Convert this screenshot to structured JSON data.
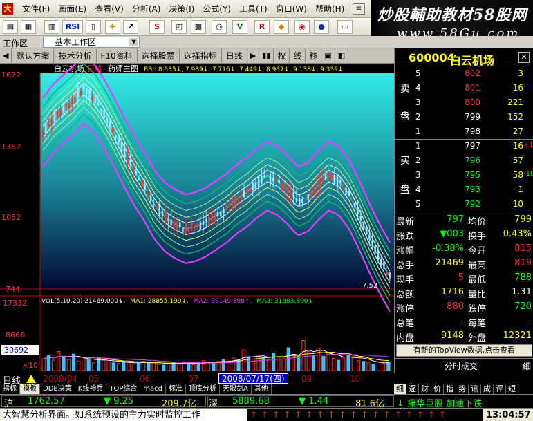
{
  "menu": [
    "文件(F)",
    "画面(E)",
    "查看(V)",
    "分析(A)",
    "决策(I)",
    "公式(Y)",
    "工具(T)",
    "窗口(W)",
    "帮助(H)"
  ],
  "banner": {
    "line1": "炒股輔助教材58股网",
    "line2": "www.58Gu.com"
  },
  "toolbar_labels": {
    "rsi": "RSI",
    "s": "S",
    "v": "V",
    "r": "R"
  },
  "workarea": {
    "label": "工作区",
    "value": "基本工作区"
  },
  "analysis_tabs": [
    "默认方案",
    "技术分析",
    "F10资料",
    "选择股票",
    "选择指标",
    "日线",
    "权",
    "线",
    "移"
  ],
  "chart_title": {
    "stock": "白云机场",
    "period": "日线",
    "indicator": "药师主图"
  },
  "bbi_line": "BBI: 8.535↓, 7.989↓, 7.716↓, 7.449↓, 8.937↓, 9.138↓, 9.339↓",
  "vol_line": {
    "prefix": "VOL(5,10,20) 21469.000↓,",
    "ma1": "MA1: 28855.199↓,",
    "ma2": "MA2: 39149.898↑,",
    "ma3": "MA3: 31883.600↓"
  },
  "price_axis": [
    "1672",
    "1362",
    "1052",
    "744"
  ],
  "vol_axis": [
    "17332",
    "8666",
    "30692",
    "×10"
  ],
  "last_price_tag": "7.52",
  "quote": {
    "code": "600004",
    "name": "白云机场",
    "sell_label_1": "卖",
    "sell_label_2": "盘",
    "buy_label_1": "买",
    "buy_label_2": "盘",
    "sell": [
      {
        "n": "5",
        "p": "802",
        "v": "3"
      },
      {
        "n": "4",
        "p": "801",
        "v": "16"
      },
      {
        "n": "3",
        "p": "800",
        "v": "221"
      },
      {
        "n": "2",
        "p": "799",
        "v": "152"
      },
      {
        "n": "1",
        "p": "798",
        "v": "27"
      }
    ],
    "buy": [
      {
        "n": "1",
        "p": "797",
        "v": "16",
        "c": "+1"
      },
      {
        "n": "2",
        "p": "796",
        "v": "57",
        "c": ""
      },
      {
        "n": "3",
        "p": "795",
        "v": "58",
        "c": "-10"
      },
      {
        "n": "4",
        "p": "793",
        "v": "1",
        "c": ""
      },
      {
        "n": "5",
        "p": "792",
        "v": "10",
        "c": ""
      }
    ],
    "stats": [
      {
        "l1": "最新",
        "v1": "797",
        "l2": "均价",
        "v2": "799"
      },
      {
        "l1": "涨跌",
        "v1": "▼003",
        "l2": "换手",
        "v2": "0.43%"
      },
      {
        "l1": "涨幅",
        "v1": "-0.38%",
        "l2": "今开",
        "v2": "815"
      },
      {
        "l1": "总手",
        "v1": "21469",
        "l2": "最高",
        "v2": "819"
      },
      {
        "l1": "现手",
        "v1": "5",
        "l2": "最低",
        "v2": "788"
      },
      {
        "l1": "总额",
        "v1": "1716",
        "l2": "量比",
        "v2": "1.31"
      },
      {
        "l1": "涨停",
        "v1": "880",
        "l2": "跌停",
        "v2": "720"
      },
      {
        "l1": "总笔",
        "v1": "-",
        "l2": "每笔",
        "v2": "-"
      },
      {
        "l1": "内盘",
        "v1": "9148",
        "l2": "外盘",
        "v2": "12321"
      }
    ],
    "topview": "有新的TopView数据,点击查看",
    "fenshi": "分时成交",
    "fenshi_right": "细"
  },
  "date_axis": {
    "period": "日线",
    "labels": [
      "2008/04",
      "05",
      "06",
      "07",
      "09",
      "10"
    ],
    "highlight": "2008/07/17(四)"
  },
  "bottom_tabs": [
    "指标",
    "模板",
    "DDE决策",
    "K线神兵",
    "TOP综合",
    "macd",
    "标准",
    "顶底分析",
    "天眼剑A",
    "其他"
  ],
  "right_tabs": [
    "细",
    "逐",
    "财",
    "价",
    "指",
    "势",
    "讯",
    "成",
    "评",
    "短"
  ],
  "index_bar": {
    "sh_label": "沪",
    "sh_value": "1762.57",
    "sh_change": "▼ 9.25",
    "sh_amount": "209.7亿",
    "sz_label": "深",
    "sz_value": "5889.68",
    "sz_change": "▼ 1.44",
    "sz_amount": "81.6亿",
    "news": "↓ 振华巨股 加速下跌"
  },
  "status": {
    "message": "大智慧分析界面。如系统预设的主力实时监控工作",
    "clock": "13:04:57"
  },
  "colors": {
    "price_up": "#ff3030",
    "price_down": "#00ff00",
    "label_text": "#ffffff",
    "volume_text": "#ffff00",
    "chart_bg_top": "#32ece6",
    "band_outer": "#e040ff",
    "band_inner": "#00e070"
  },
  "chart_data": {
    "type": "line",
    "price_levels": [
      1672,
      1362,
      1052,
      744
    ],
    "price_ylim": [
      744,
      1672
    ],
    "volume_levels": [
      17332,
      8666
    ],
    "volume_ylim": [
      0,
      17332
    ],
    "last_price": 7.52,
    "x_labels": [
      "2008/04",
      "05",
      "06",
      "07",
      "2008/07/17(四)",
      "09",
      "10"
    ],
    "center_path": [
      1420,
      1480,
      1520,
      1560,
      1610,
      1570,
      1500,
      1420,
      1330,
      1250,
      1180,
      1100,
      1050,
      1020,
      1000,
      1010,
      1030,
      1060,
      1090,
      1130,
      1160,
      1200,
      1230,
      1210,
      1170,
      1120,
      1140,
      1190,
      1230,
      1210,
      1150,
      1060,
      960,
      870,
      790
    ],
    "volume_bars": [
      3200,
      4100,
      2800,
      5200,
      3900,
      3000,
      4500,
      2600,
      3100,
      2900,
      2200,
      3600,
      2800,
      2400,
      2100,
      1900,
      2600,
      2200,
      1800,
      2100,
      2500,
      2000,
      2300,
      1700,
      1500,
      1900,
      2200,
      1800,
      2400,
      2100,
      1600,
      2300,
      2700,
      2200,
      1900,
      2500,
      3000,
      2600,
      3400,
      2900,
      5600,
      3800,
      3100,
      4200,
      3500,
      2900,
      4800,
      3600,
      3200,
      6200,
      4400,
      3800,
      8200,
      5200,
      4100,
      6100,
      3900,
      4700,
      3300,
      2800,
      3600,
      4200,
      3900,
      2700,
      2500,
      2100,
      1800,
      2300,
      1900,
      2400
    ]
  }
}
